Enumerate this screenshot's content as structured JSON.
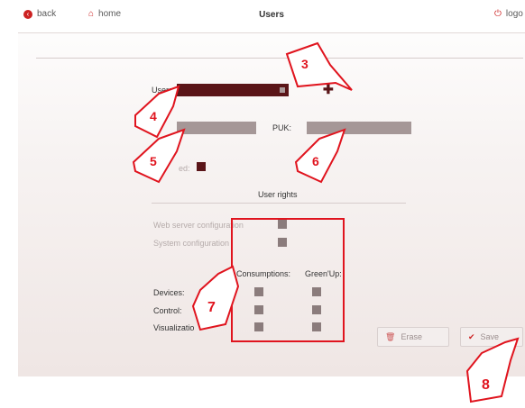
{
  "nav": {
    "back": "back",
    "home": "home",
    "title": "Users",
    "logout": "logo"
  },
  "form": {
    "user_label": "User:",
    "puk_label": "PUK:",
    "enabled_label": "ed:",
    "rights_title": "User rights",
    "web_server": "Web server configuration",
    "system_config": "System configuration",
    "col_consumptions": "Consumptions:",
    "col_greenup": "Green'Up:",
    "row_devices": "Devices:",
    "row_control": "Control:",
    "row_visualization": "Visualizatio"
  },
  "buttons": {
    "erase": "Erase",
    "save": "Save"
  },
  "callouts": [
    "3",
    "4",
    "5",
    "6",
    "7",
    "8"
  ],
  "colors": {
    "accent_red": "#e0141e",
    "field_dark": "#5a1518",
    "field_tan": "#a59797",
    "checkbox": "#8b7c7c"
  }
}
